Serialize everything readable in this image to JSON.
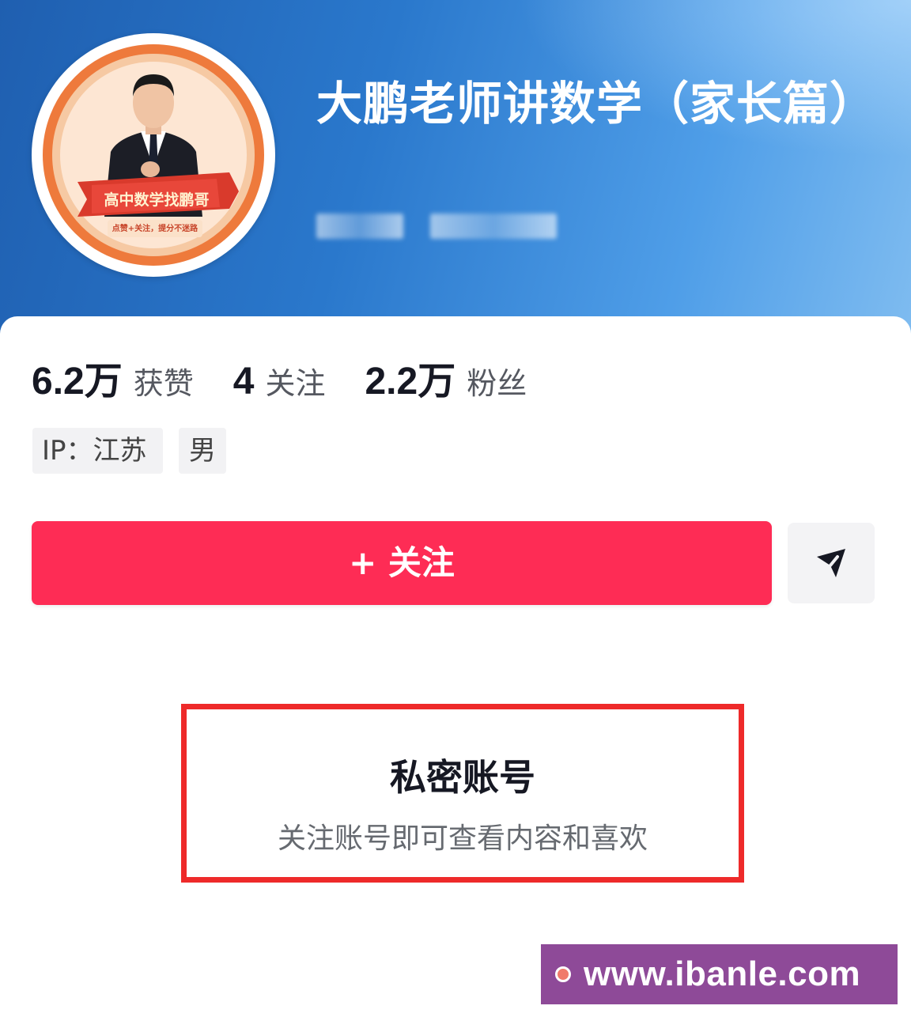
{
  "profile": {
    "name": "大鹏老师讲数学（家长篇）",
    "avatar_banner": "高中数学找鹏哥",
    "avatar_slogan": "点赞+关注，提分不迷路"
  },
  "stats": [
    {
      "value": "6.2万",
      "label": "获赞"
    },
    {
      "value": "4",
      "label": "关注"
    },
    {
      "value": "2.2万",
      "label": "粉丝"
    }
  ],
  "tags": {
    "ip": "IP：江苏",
    "gender": "男"
  },
  "actions": {
    "follow_label": "+ 关注",
    "share_icon": "send-icon"
  },
  "private_notice": {
    "title": "私密账号",
    "description": "关注账号即可查看内容和喜欢"
  },
  "watermark": {
    "text": "www.ibanle.com"
  },
  "colors": {
    "follow_button": "#fe2c55",
    "highlight_border": "#ee2a2a",
    "header_gradient_start": "#1f5fb0",
    "header_gradient_end": "#7fbcf0",
    "watermark_bg": "#8e4a98"
  }
}
